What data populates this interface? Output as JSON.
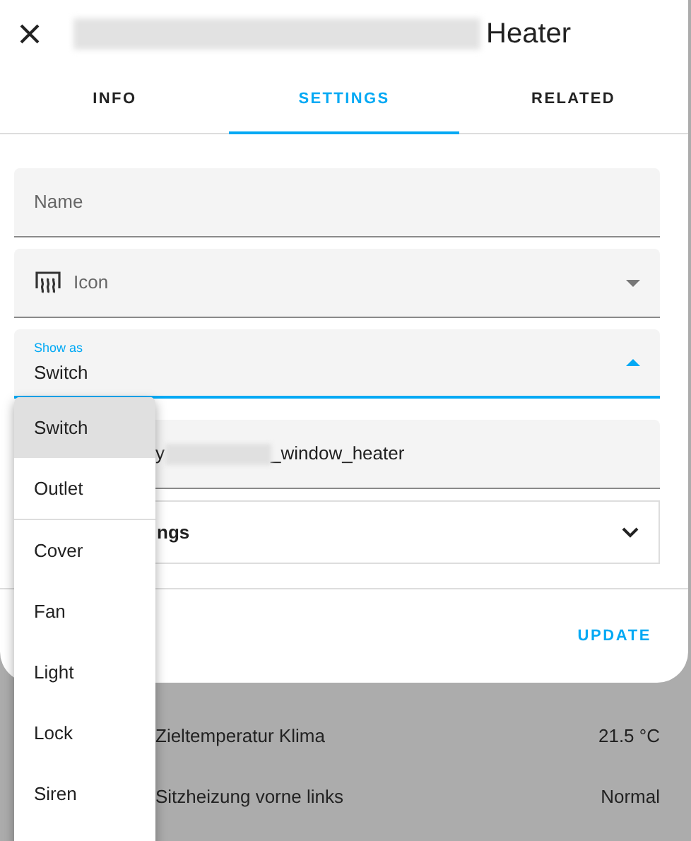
{
  "dialog": {
    "title": "Heater",
    "tabs": [
      {
        "label": "INFO",
        "selected": false
      },
      {
        "label": "SETTINGS",
        "selected": true
      },
      {
        "label": "RELATED",
        "selected": false
      }
    ],
    "fields": [
      {
        "kind": "text",
        "label": "Name"
      },
      {
        "kind": "icon-select",
        "label": "Icon"
      },
      {
        "kind": "select",
        "label": "Show as",
        "value": "Switch",
        "expanded": true
      },
      {
        "kind": "entity",
        "value_start": "y",
        "value_end": "_window_heater"
      }
    ],
    "advanced": {
      "label": "ngs",
      "expanded": false
    },
    "update_button": "UPDATE"
  },
  "dropdown": {
    "groups": [
      [
        {
          "label": "Switch",
          "selected": true
        },
        {
          "label": "Outlet",
          "selected": false
        }
      ],
      [
        {
          "label": "Cover",
          "selected": false
        },
        {
          "label": "Fan",
          "selected": false
        },
        {
          "label": "Light",
          "selected": false
        },
        {
          "label": "Lock",
          "selected": false
        },
        {
          "label": "Siren",
          "selected": false
        }
      ]
    ]
  },
  "background_rows": [
    {
      "label": "Zieltemperatur Klima",
      "value": "21.5 °C"
    },
    {
      "label": "Sitzheizung vorne links",
      "value": "Normal"
    }
  ]
}
